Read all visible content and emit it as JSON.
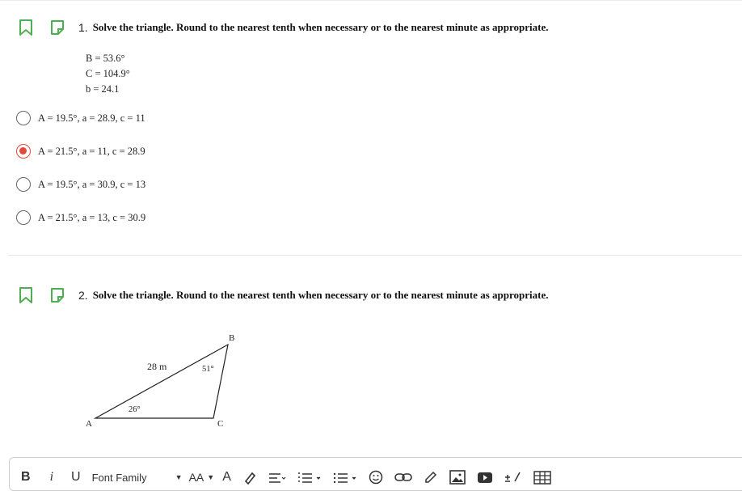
{
  "question1": {
    "number": "1.",
    "prompt": "Solve the triangle. Round to the nearest tenth when necessary or to the nearest minute as appropriate.",
    "given": [
      "B = 53.6°",
      "C = 104.9°",
      "b = 24.1"
    ],
    "options": [
      {
        "label": "A = 19.5°, a = 28.9, c = 11",
        "selected": false
      },
      {
        "label": "A = 21.5°, a = 11, c = 28.9",
        "selected": true
      },
      {
        "label": "A = 19.5°, a = 30.9, c = 13",
        "selected": false
      },
      {
        "label": "A = 21.5°, a = 13, c = 30.9",
        "selected": false
      }
    ]
  },
  "question2": {
    "number": "2.",
    "prompt": "Solve the triangle. Round to the nearest tenth when necessary or to the nearest minute as appropriate.",
    "figure": {
      "vertex_a": "A",
      "vertex_b": "B",
      "vertex_c": "C",
      "side_label": "28 m",
      "angle_b": "51°",
      "angle_a": "26°"
    }
  },
  "toolbar": {
    "bold": "B",
    "italic": "i",
    "underline": "U",
    "font_family": "Font Family",
    "font_size": "AA",
    "text_format": "A"
  },
  "colors": {
    "icon_green": "#4caf50",
    "selected_radio": "#e04a3e"
  }
}
